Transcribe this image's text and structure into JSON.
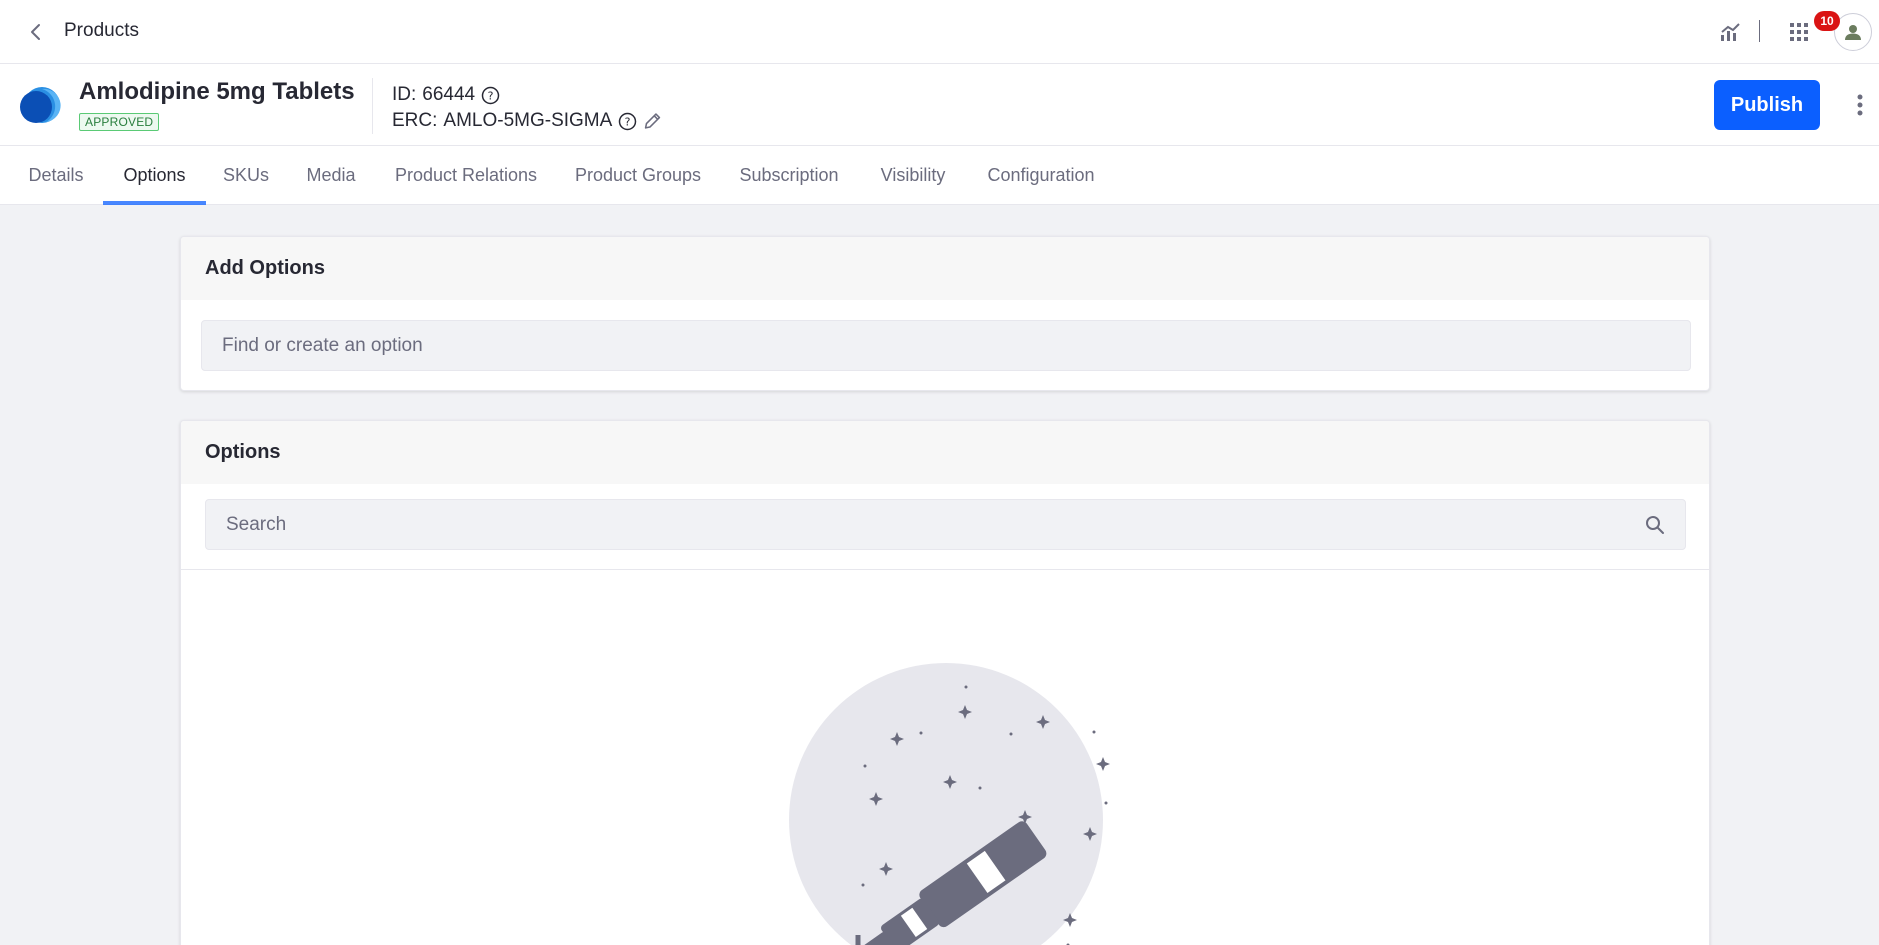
{
  "topbar": {
    "title": "Products",
    "notification_count": "10"
  },
  "product": {
    "name": "Amlodipine 5mg Tablets",
    "status": "APPROVED",
    "id_key": "ID:",
    "id_value": "66444",
    "erc_key": "ERC:",
    "erc_value": "AMLO-5MG-SIGMA",
    "publish_label": "Publish"
  },
  "tabs": [
    {
      "label": "Details"
    },
    {
      "label": "Options",
      "active": true
    },
    {
      "label": "SKUs"
    },
    {
      "label": "Media"
    },
    {
      "label": "Product Relations"
    },
    {
      "label": "Product Groups"
    },
    {
      "label": "Subscription"
    },
    {
      "label": "Visibility"
    },
    {
      "label": "Configuration"
    }
  ],
  "add_options": {
    "title": "Add Options",
    "placeholder": "Find or create an option"
  },
  "options": {
    "title": "Options",
    "search_placeholder": "Search"
  },
  "colors": {
    "primary": "#0b5fff",
    "badge": "#da1414",
    "approved": "#287d3c"
  }
}
